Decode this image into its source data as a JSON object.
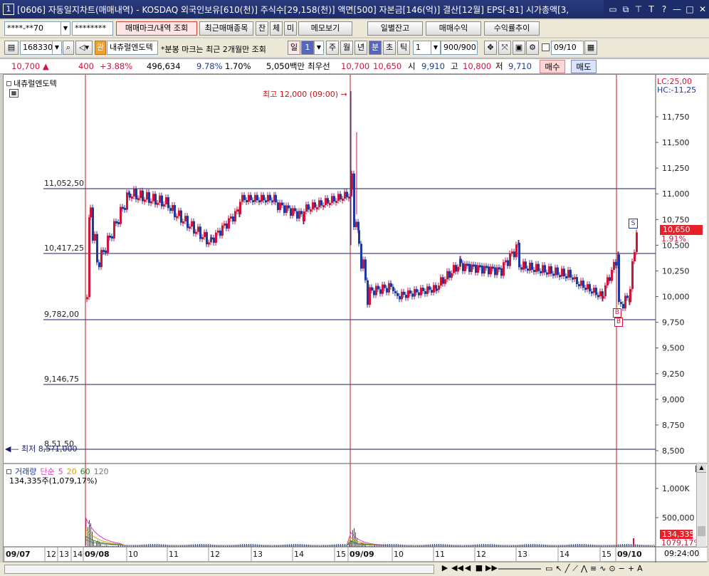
{
  "window": {
    "title_num": "1",
    "title": "[0606] 자동일지차트(매매내역) - KOSDAQ 외국인보유[610(천)] 주식수[29,158(천)] 액면[500] 자본금[146(억)] 결산[12월] EPS[-81] 시가총액[3,"
  },
  "toolbar1": {
    "account": "****-**70",
    "password": "********",
    "btn_query": "매매마크/내역 조회",
    "btn_recent": "최근매매종목",
    "btn_jan": "잔",
    "btn_che": "체",
    "btn_mi": "미",
    "btn_memo": "메모보기",
    "btn_daily": "일별잔고",
    "btn_profit": "매매수익",
    "btn_rate": "수익률추이"
  },
  "toolbar2": {
    "code": "168330",
    "stock_badge": "관",
    "stock_name": "내츄럴엔도텍",
    "notice": "*분봉 마크는 최근 2개월만 조회",
    "period_label": "일",
    "interval": "1",
    "tabs": [
      "주",
      "월",
      "년",
      "분",
      "초",
      "틱"
    ],
    "tick_value": "1",
    "count": "900/900",
    "date": "09/10"
  },
  "quote": {
    "price": "10,700",
    "change": "400",
    "change_pct": "+3.88%",
    "volume": "496,634",
    "turnover": "9.78%",
    "ratio": "1.70%",
    "amount": "5,050백만",
    "best_label": "최우선",
    "ask": "10,700",
    "bid": "10,650",
    "open_label": "시",
    "open": "9,910",
    "high_label": "고",
    "high": "10,800",
    "low_label": "저",
    "low": "9,710",
    "buy": "매수",
    "sell": "매도"
  },
  "chart": {
    "stock_title": "내츄럴엔도텍",
    "lc": "LC:25,00",
    "hc": "HC:-11,25",
    "high_label": "최고 12,000 (09:00)",
    "low_label": "최저 8,5?1,000",
    "price_tag": "10,650",
    "pct_tag": "1.91%",
    "mark_s": "S",
    "mark_b": "B",
    "price_ticks": [
      "11,750",
      "11,500",
      "11,250",
      "11,000",
      "10,750",
      "10,500",
      "10,250",
      "10,000",
      "9,750",
      "9,500",
      "9,250",
      "9,000",
      "8,750",
      "8,500"
    ],
    "levels": [
      "11,052,50",
      "10,417,25",
      "9,782,00",
      "9,146,75",
      "8,51,50"
    ],
    "volume_title": "거래량",
    "ma_label": "단순",
    "ma_values": [
      "5",
      "20",
      "60",
      "120"
    ],
    "volume_value": "134,335주(1,079,17%)",
    "vol_ticks": [
      "1,000K",
      "500,000"
    ],
    "vol_tag": "134,335",
    "vol_pct_tag": "1079,17%",
    "x_labels": [
      {
        "t": "09/07",
        "b": true
      },
      {
        "t": "12",
        "b": false
      },
      {
        "t": "13",
        "b": false
      },
      {
        "t": "14",
        "b": false
      },
      {
        "t": "09/08",
        "b": true
      },
      {
        "t": "10",
        "b": false
      },
      {
        "t": "11",
        "b": false
      },
      {
        "t": "12",
        "b": false
      },
      {
        "t": "13",
        "b": false
      },
      {
        "t": "14",
        "b": false
      },
      {
        "t": "15",
        "b": false
      },
      {
        "t": "09/09",
        "b": true
      },
      {
        "t": "10",
        "b": false
      },
      {
        "t": "11",
        "b": false
      },
      {
        "t": "12",
        "b": false
      },
      {
        "t": "13",
        "b": false
      },
      {
        "t": "14",
        "b": false
      },
      {
        "t": "15",
        "b": false
      },
      {
        "t": "09/10",
        "b": true
      }
    ],
    "time": "09:24:00"
  },
  "colors": {
    "up": "#d0143a",
    "down": "#1e3aa0",
    "level": "#1a1a6e",
    "vline": "#c01818",
    "ma5": "#d63cc4",
    "ma20": "#d8a000",
    "ma60": "#2a8a2a",
    "ma120": "#777777"
  }
}
